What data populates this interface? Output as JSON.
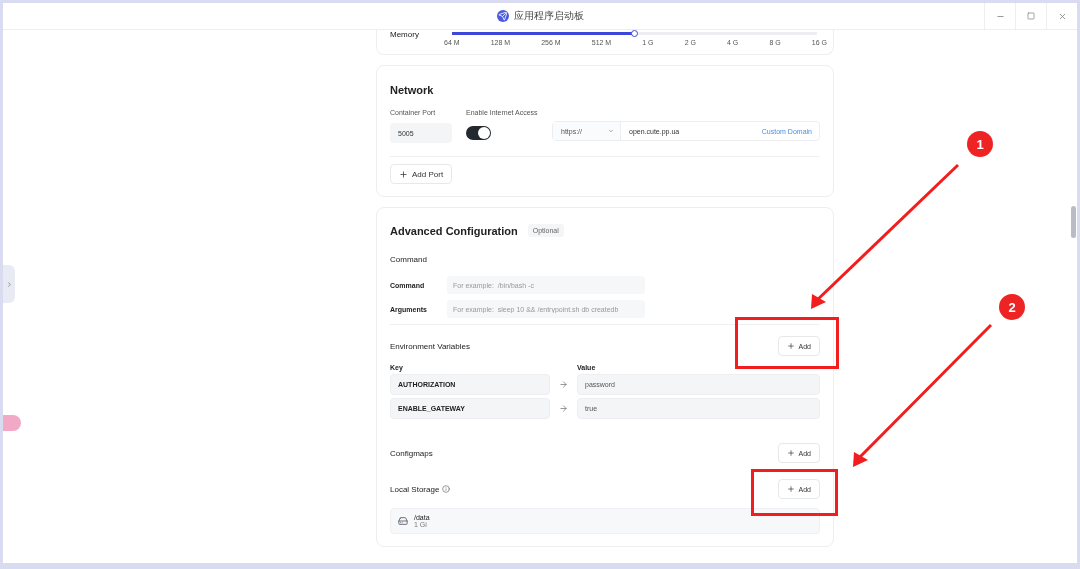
{
  "window": {
    "title": "应用程序启动板"
  },
  "memory": {
    "label": "Memory",
    "level": 0.5,
    "ticks": [
      "64 M",
      "128 M",
      "256 M",
      "512 M",
      "1 G",
      "2 G",
      "4 G",
      "8 G",
      "16 G"
    ]
  },
  "network": {
    "title": "Network",
    "port_label": "Container Port",
    "port_value": "5005",
    "access_label": "Enable Internet Access",
    "access_on": true,
    "protocol": "https://",
    "domain": "open.cute.pp.ua",
    "custom_domain": "Custom Domain",
    "add_port": "Add Port"
  },
  "advanced": {
    "title": "Advanced Configuration",
    "badge": "Optional",
    "command_title": "Command",
    "fields": [
      {
        "label": "Command",
        "placeholder": "For example:  /bin/bash -c"
      },
      {
        "label": "Arguments",
        "placeholder": "For example:  sleep 10 && /entrypoint.sh db createdb"
      }
    ],
    "env": {
      "title": "Environment Variables",
      "add": "Add",
      "key_header": "Key",
      "value_header": "Value",
      "rows": [
        {
          "key": "AUTHORIZATION",
          "value": "password"
        },
        {
          "key": "ENABLE_GATEWAY",
          "value": "true"
        }
      ]
    },
    "configmaps": {
      "title": "Configmaps",
      "add": "Add"
    },
    "storage": {
      "title": "Local Storage",
      "add": "Add",
      "items": [
        {
          "path": "/data",
          "size": "1 Gi"
        }
      ]
    }
  },
  "annotations": [
    {
      "number": "1"
    },
    {
      "number": "2"
    }
  ]
}
